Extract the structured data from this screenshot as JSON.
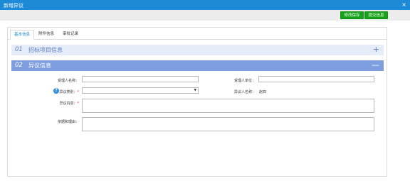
{
  "window": {
    "title": "新增异议",
    "close_glyph": "×"
  },
  "toolbar": {
    "edit_save_label": "修改保存",
    "submit_label": "提交信息"
  },
  "tabs": [
    {
      "label": "基本信息",
      "active": true
    },
    {
      "label": "附件信息",
      "active": false
    },
    {
      "label": "审批记录",
      "active": false
    }
  ],
  "sections": [
    {
      "number": "01",
      "title": "招标项目信息",
      "toggle": "+"
    },
    {
      "number": "02",
      "title": "异议信息",
      "toggle": "—"
    }
  ],
  "form": {
    "receiver_name_label": "受理人名称：",
    "receiver_name_value": "",
    "receiver_unit_label": "受理人单位：",
    "receiver_unit_value": "",
    "objection_type_label": "异议类别：",
    "objection_type_value": "",
    "objector_name_label": "异议人名称：",
    "objector_name_value": "赵四",
    "objection_content_label": "异议内容：",
    "objection_content_value": "",
    "basis_reason_label": "依据和理由：",
    "basis_reason_value": "",
    "required_mark": "*",
    "help_glyph": "?",
    "select_arrow": "▼"
  },
  "colors": {
    "titlebar": "#1c8ad6",
    "button": "#15a31a",
    "section_collapsed": "#e6ecf7",
    "section_expanded": "#7e9edf"
  }
}
